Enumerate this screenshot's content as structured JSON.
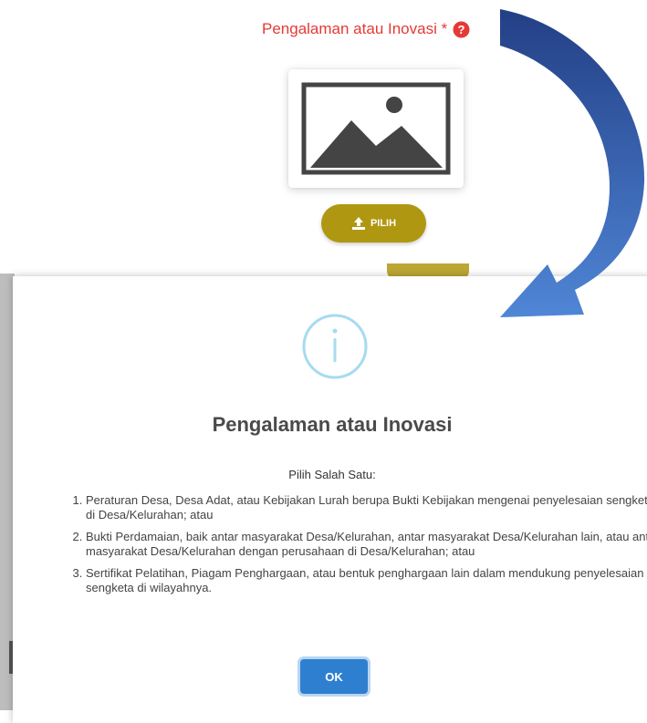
{
  "field": {
    "label": "Pengalaman atau Inovasi *",
    "help_icon": "question-circle-icon",
    "preview_icon": "image-placeholder-icon"
  },
  "upload": {
    "button_label": "PILIH",
    "button_icon": "upload-icon",
    "button_color": "#b09711"
  },
  "annotation": {
    "arrow_icon": "curved-arrow-icon",
    "arrow_color": "#2f5aa8"
  },
  "modal": {
    "icon": "info-icon",
    "title": "Pengalaman atau Inovasi",
    "subtitle": "Pilih Salah Satu:",
    "items": [
      "Peraturan Desa, Desa Adat, atau Kebijakan Lurah berupa Bukti Kebijakan mengenai penyelesaian sengketa di Desa/Kelurahan; atau",
      "Bukti Perdamaian, baik antar masyarakat Desa/Kelurahan, antar masyarakat Desa/Kelurahan lain, atau antar masyarakat Desa/Kelurahan dengan perusahaan di Desa/Kelurahan; atau",
      "Sertifikat Pelatihan, Piagam Penghargaan, atau bentuk penghargaan lain dalam mendukung penyelesaian sengketa di wilayahnya."
    ],
    "ok_label": "OK",
    "ok_color": "#2f7fd1"
  }
}
